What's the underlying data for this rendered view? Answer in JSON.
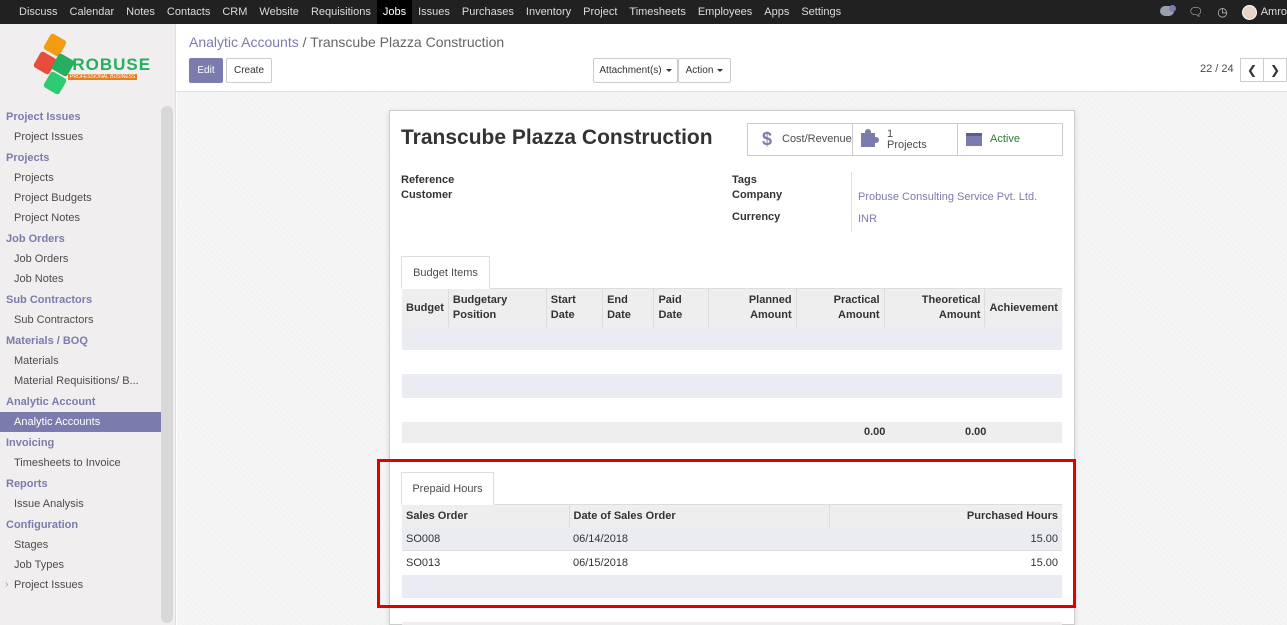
{
  "topbar": {
    "menu": [
      "Discuss",
      "Calendar",
      "Notes",
      "Contacts",
      "CRM",
      "Website",
      "Requisitions",
      "Jobs",
      "Issues",
      "Purchases",
      "Inventory",
      "Project",
      "Timesheets",
      "Employees",
      "Apps",
      "Settings"
    ],
    "active_menu": "Jobs",
    "user": "Amro"
  },
  "logo": {
    "name": "PROBUSE",
    "tagline": "PROFESSIONAL BUSINESS"
  },
  "sidebar": {
    "sections": [
      {
        "title": "Project Issues",
        "items": [
          "Project Issues"
        ]
      },
      {
        "title": "Projects",
        "items": [
          "Projects",
          "Project Budgets",
          "Project Notes"
        ]
      },
      {
        "title": "Job Orders",
        "items": [
          "Job Orders",
          "Job Notes"
        ]
      },
      {
        "title": "Sub Contractors",
        "items": [
          "Sub Contractors"
        ]
      },
      {
        "title": "Materials / BOQ",
        "items": [
          "Materials",
          "Material Requisitions/ B..."
        ]
      },
      {
        "title": "Analytic Account",
        "items": [
          "Analytic Accounts"
        ]
      },
      {
        "title": "Invoicing",
        "items": [
          "Timesheets to Invoice"
        ]
      },
      {
        "title": "Reports",
        "items": [
          "Issue Analysis"
        ]
      },
      {
        "title": "Configuration",
        "items": [
          "Stages",
          "Job Types",
          "Project Issues"
        ]
      }
    ],
    "active_item": "Analytic Accounts"
  },
  "breadcrumb": {
    "parent": "Analytic Accounts",
    "separator": "/",
    "current": "Transcube Plazza Construction"
  },
  "toolbar": {
    "edit_label": "Edit",
    "create_label": "Create",
    "attachments_label": "Attachment(s)",
    "action_label": "Action"
  },
  "pager": {
    "value": "22 / 24",
    "prev": "<",
    "next": ">"
  },
  "record": {
    "title": "Transcube Plazza Construction",
    "stat_buttons": {
      "cost_revenue": "Cost/Revenue",
      "projects_count": "1",
      "projects_label": "Projects",
      "active": "Active"
    },
    "fields": {
      "reference_label": "Reference",
      "customer_label": "Customer",
      "tags_label": "Tags",
      "company_label": "Company",
      "company_value": "Probuse Consulting Service Pvt. Ltd.",
      "currency_label": "Currency",
      "currency_value": "INR"
    }
  },
  "budget_items": {
    "tab_label": "Budget Items",
    "columns": {
      "budget": "Budget",
      "budgetary_position_1": "Budgetary",
      "budgetary_position_2": "Position",
      "start_date_1": "Start",
      "start_date_2": "Date",
      "end_date_1": "End",
      "end_date_2": "Date",
      "paid_date_1": "Paid",
      "paid_date_2": "Date",
      "planned_1": "Planned",
      "planned_2": "Amount",
      "practical_1": "Practical",
      "practical_2": "Amount",
      "theoretical_1": "Theoretical",
      "theoretical_2": "Amount",
      "achievement": "Achievement"
    },
    "totals": {
      "practical": "0.00",
      "theoretical": "0.00"
    }
  },
  "prepaid_hours": {
    "tab_label": "Prepaid Hours",
    "columns": {
      "sales_order": "Sales Order",
      "date": "Date of Sales Order",
      "hours": "Purchased Hours"
    },
    "rows": [
      {
        "sales_order": "SO008",
        "date": "06/14/2018",
        "hours": "15.00"
      },
      {
        "sales_order": "SO013",
        "date": "06/15/2018",
        "hours": "15.00"
      }
    ]
  },
  "colors": {
    "accent": "#7c7bad",
    "topbar": "#212121",
    "highlight": "#e00000"
  }
}
